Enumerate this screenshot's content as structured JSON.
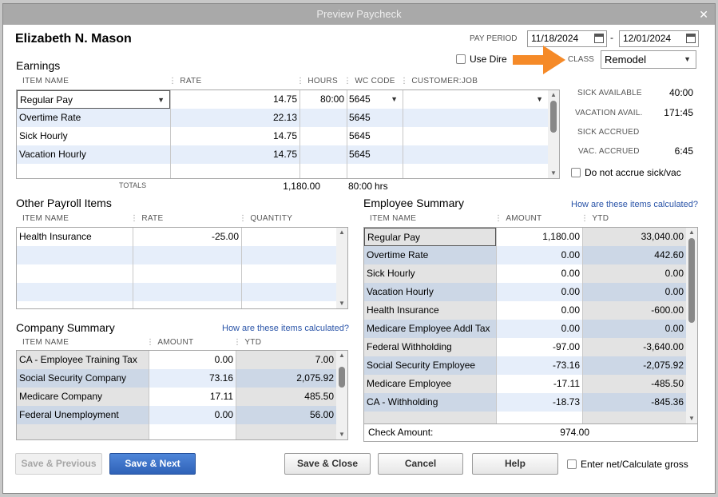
{
  "window": {
    "title": "Preview Paycheck"
  },
  "employee": {
    "name": "Elizabeth N. Mason"
  },
  "pay_period": {
    "label": "PAY PERIOD",
    "start": "11/18/2024",
    "sep": "-",
    "end": "12/01/2024"
  },
  "use_direct_deposit": {
    "label": "Use Dire"
  },
  "class_field": {
    "label": "CLASS",
    "value": "Remodel"
  },
  "earnings": {
    "title": "Earnings",
    "headers": {
      "item": "ITEM NAME",
      "rate": "RATE",
      "hours": "HOURS",
      "wc": "WC CODE",
      "customer": "CUSTOMER:JOB"
    },
    "rows": [
      {
        "item": "Regular Pay",
        "rate": "14.75",
        "hours": "80:00",
        "wc": "5645",
        "customer": ""
      },
      {
        "item": "Overtime Rate",
        "rate": "22.13",
        "hours": "",
        "wc": "5645",
        "customer": ""
      },
      {
        "item": "Sick Hourly",
        "rate": "14.75",
        "hours": "",
        "wc": "5645",
        "customer": ""
      },
      {
        "item": "Vacation Hourly",
        "rate": "14.75",
        "hours": "",
        "wc": "5645",
        "customer": ""
      }
    ],
    "totals": {
      "label": "TOTALS",
      "amount": "1,180.00",
      "hours": "80:00",
      "unit": "hrs"
    }
  },
  "sick_vac": {
    "sick_available": {
      "label": "SICK AVAILABLE",
      "value": "40:00"
    },
    "vacation_avail": {
      "label": "VACATION AVAIL.",
      "value": "171:45"
    },
    "sick_accrued": {
      "label": "SICK ACCRUED",
      "value": ""
    },
    "vac_accrued": {
      "label": "VAC. ACCRUED",
      "value": "6:45"
    },
    "do_not_accrue": "Do not accrue sick/vac"
  },
  "other_payroll": {
    "title": "Other Payroll Items",
    "headers": {
      "item": "ITEM NAME",
      "rate": "RATE",
      "quantity": "QUANTITY"
    },
    "rows": [
      {
        "item": "Health Insurance",
        "rate": "-25.00",
        "quantity": ""
      }
    ]
  },
  "company_summary": {
    "title": "Company Summary",
    "link": "How are these items calculated?",
    "headers": {
      "item": "ITEM NAME",
      "amount": "AMOUNT",
      "ytd": "YTD"
    },
    "rows": [
      {
        "item": "CA - Employee Training Tax",
        "amount": "0.00",
        "ytd": "7.00"
      },
      {
        "item": "Social Security Company",
        "amount": "73.16",
        "ytd": "2,075.92"
      },
      {
        "item": "Medicare Company",
        "amount": "17.11",
        "ytd": "485.50"
      },
      {
        "item": "Federal Unemployment",
        "amount": "0.00",
        "ytd": "56.00"
      }
    ]
  },
  "employee_summary": {
    "title": "Employee Summary",
    "link": "How are these items calculated?",
    "headers": {
      "item": "ITEM NAME",
      "amount": "AMOUNT",
      "ytd": "YTD"
    },
    "rows": [
      {
        "item": "Regular Pay",
        "amount": "1,180.00",
        "ytd": "33,040.00"
      },
      {
        "item": "Overtime Rate",
        "amount": "0.00",
        "ytd": "442.60"
      },
      {
        "item": "Sick Hourly",
        "amount": "0.00",
        "ytd": "0.00"
      },
      {
        "item": "Vacation Hourly",
        "amount": "0.00",
        "ytd": "0.00"
      },
      {
        "item": "Health Insurance",
        "amount": "0.00",
        "ytd": "-600.00"
      },
      {
        "item": "Medicare Employee Addl Tax",
        "amount": "0.00",
        "ytd": "0.00"
      },
      {
        "item": "Federal Withholding",
        "amount": "-97.00",
        "ytd": "-3,640.00"
      },
      {
        "item": "Social Security Employee",
        "amount": "-73.16",
        "ytd": "-2,075.92"
      },
      {
        "item": "Medicare Employee",
        "amount": "-17.11",
        "ytd": "-485.50"
      },
      {
        "item": "CA - Withholding",
        "amount": "-18.73",
        "ytd": "-845.36"
      }
    ],
    "check_amount": {
      "label": "Check Amount:",
      "value": "974.00"
    }
  },
  "buttons": {
    "save_previous": "Save & Previous",
    "save_next": "Save & Next",
    "save_close": "Save & Close",
    "cancel": "Cancel",
    "help": "Help"
  },
  "enter_net": {
    "label": "Enter net/Calculate gross"
  },
  "colors": {
    "accent_blue": "#3a6fc8",
    "arrow_orange": "#f58a28",
    "link": "#2a54a8",
    "titlebar": "#a9a9a9"
  },
  "icons": {
    "close": "close-icon",
    "calendar": "calendar-icon",
    "dropdown": "chevron-down-icon",
    "annotation": "arrow-annotation-icon"
  }
}
